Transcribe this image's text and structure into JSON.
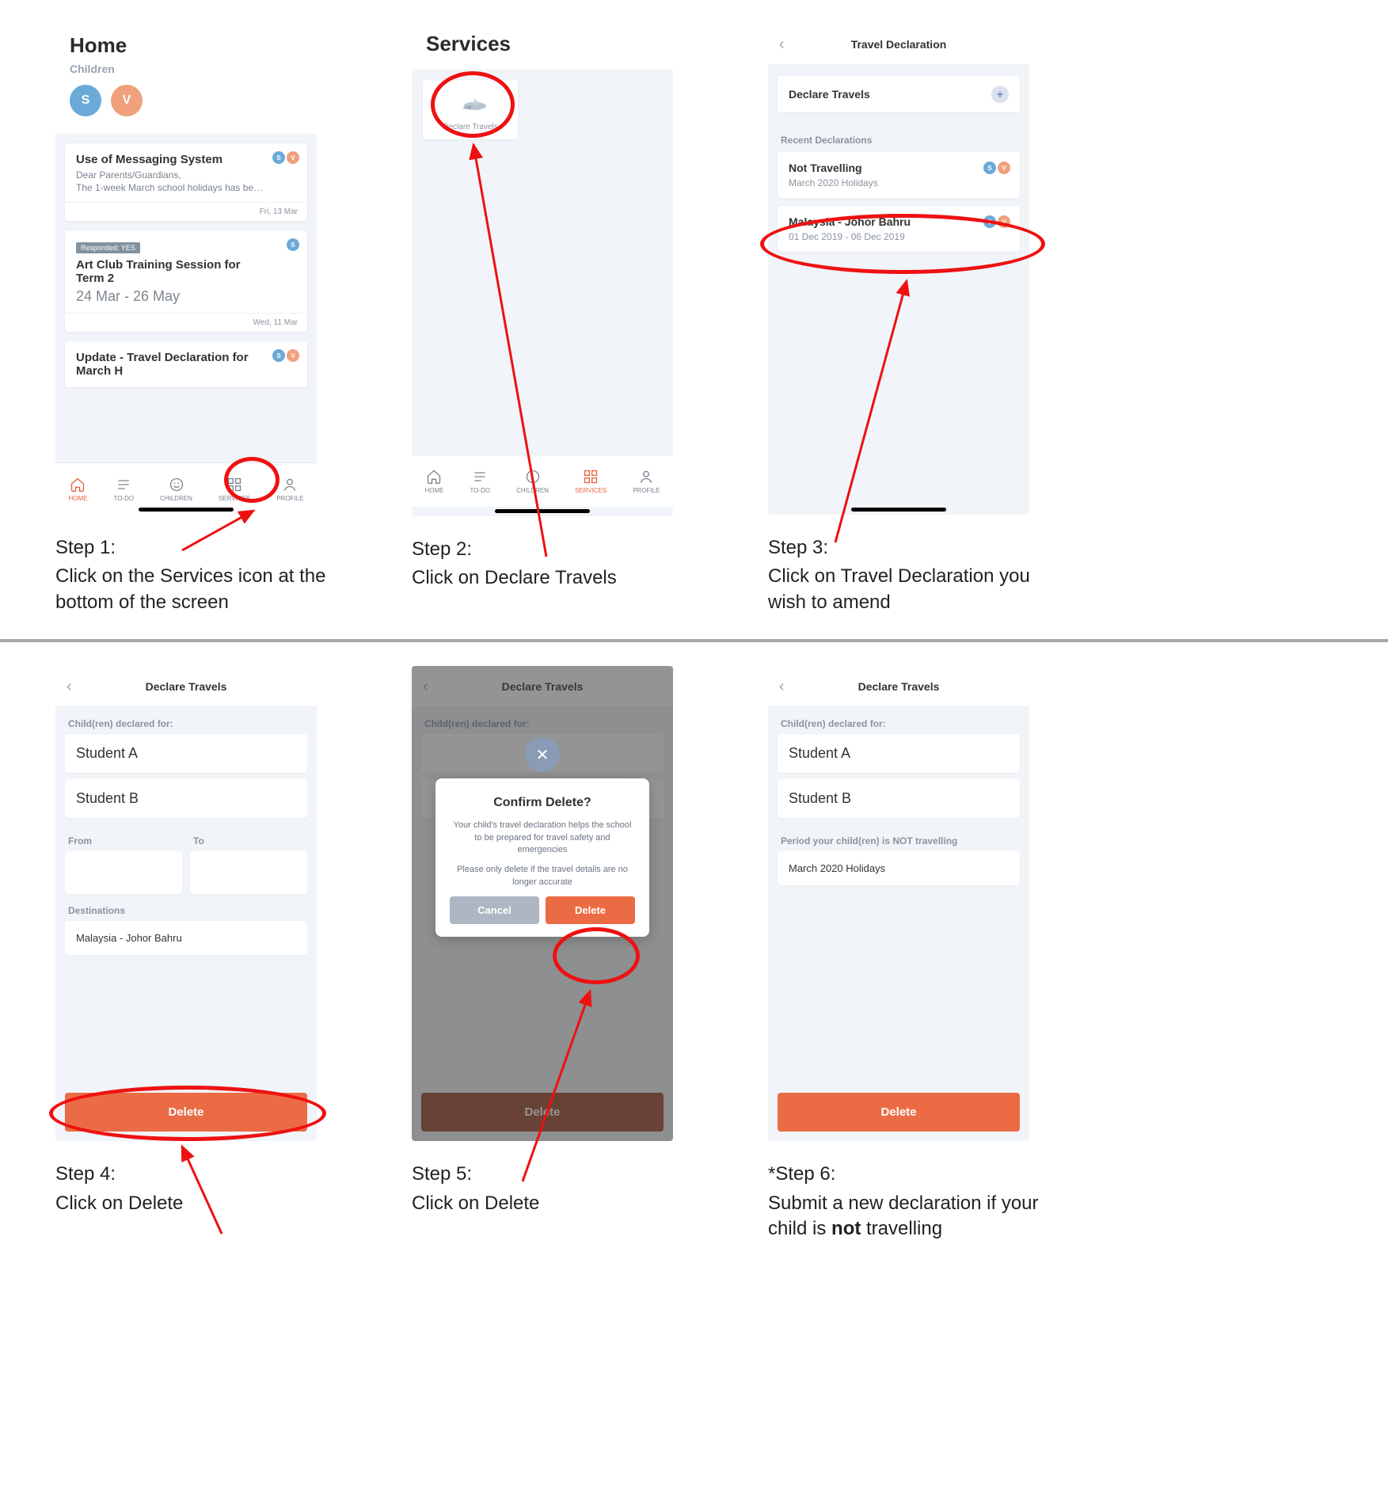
{
  "step1": {
    "screen_title": "Home",
    "subtitle": "Children",
    "avatar1": "S",
    "avatar2": "V",
    "card1": {
      "title": "Use of Messaging System",
      "line1": "Dear Parents/Guardians,",
      "line2": "The 1-week March school holidays has be…",
      "date": "Fri, 13 Mar"
    },
    "card2": {
      "badge": "Responded: YES",
      "title": "Art Club Training Session for Term 2",
      "range": "24 Mar - 26 May",
      "date": "Wed, 11 Mar"
    },
    "card3": {
      "title": "Update - Travel Declaration for March H"
    },
    "tabs": [
      "HOME",
      "TO-DO",
      "CHILDREN",
      "SERVICES",
      "PROFILE"
    ],
    "caption_title": "Step 1:",
    "caption_body": "Click on the Services icon at the bottom of the screen"
  },
  "step2": {
    "screen_title": "Services",
    "tile_label": "Declare Travels",
    "tabs": [
      "HOME",
      "TO-DO",
      "CHILDREN",
      "SERVICES",
      "PROFILE"
    ],
    "caption_title": "Step 2:",
    "caption_body": "Click on Declare Travels"
  },
  "step3": {
    "nav_title": "Travel Declaration",
    "declare_title": "Declare Travels",
    "section": "Recent Declarations",
    "row1": {
      "title": "Not Travelling",
      "sub": "March 2020 Holidays"
    },
    "row2": {
      "title": "Malaysia - Johor Bahru",
      "sub": "01 Dec 2019 - 06 Dec 2019"
    },
    "caption_title": "Step 3:",
    "caption_body": "Click on Travel Declaration you wish to amend"
  },
  "step4": {
    "nav_title": "Declare Travels",
    "label_children": "Child(ren) declared for:",
    "student_a": "Student A",
    "student_b": "Student B",
    "from": "From",
    "to": "To",
    "destinations": "Destinations",
    "dest_value": "Malaysia - Johor Bahru",
    "delete": "Delete",
    "caption_title": "Step 4:",
    "caption_body": "Click on Delete"
  },
  "step5": {
    "nav_title": "Declare Travels",
    "label_children": "Child(ren) declared for:",
    "delete": "Delete",
    "modal": {
      "title": "Confirm Delete?",
      "p1": "Your child's travel declaration helps the school to be prepared for travel safety and emergencies",
      "p2": "Please only delete if the travel details are no longer accurate",
      "cancel": "Cancel",
      "delete": "Delete"
    },
    "caption_title": "Step 5:",
    "caption_body": "Click on Delete"
  },
  "step6": {
    "nav_title": "Declare Travels",
    "label_children": "Child(ren) declared for:",
    "student_a": "Student A",
    "student_b": "Student B",
    "period_label": "Period your child(ren) is NOT travelling",
    "period_value": "March 2020 Holidays",
    "delete": "Delete",
    "caption_title": "*Step 6:",
    "caption_body_pre": "Submit a new declaration if your child is ",
    "caption_body_bold": "not",
    "caption_body_post": " travelling"
  }
}
